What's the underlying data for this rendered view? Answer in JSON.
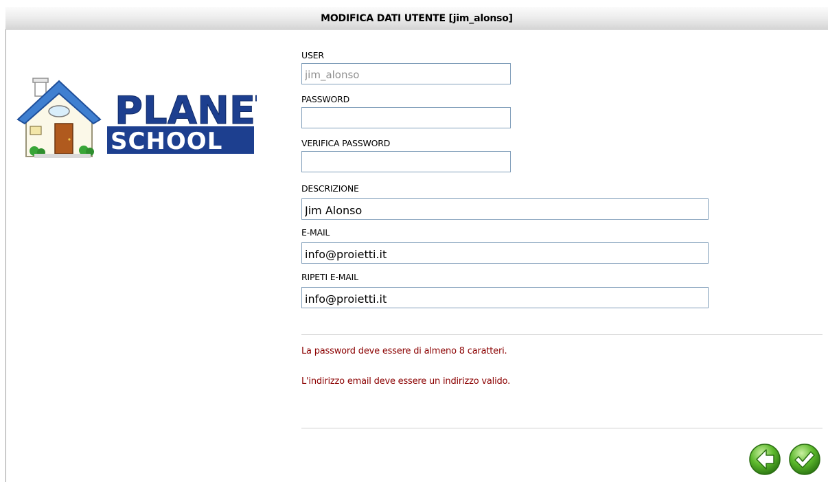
{
  "header": {
    "title": "MODIFICA DATI UTENTE [jim_alonso]"
  },
  "logo": {
    "line1": "PLANET",
    "line2": "SCHOOL"
  },
  "form": {
    "user": {
      "label": "USER",
      "value": "jim_alonso"
    },
    "password": {
      "label": "PASSWORD",
      "value": ""
    },
    "verify_password": {
      "label": "VERIFICA PASSWORD",
      "value": ""
    },
    "description": {
      "label": "DESCRIZIONE",
      "value": "Jim Alonso"
    },
    "email": {
      "label": "E-MAIL",
      "value": "info@proietti.it"
    },
    "repeat_email": {
      "label": "RIPETI E-MAIL",
      "value": "info@proietti.it"
    }
  },
  "errors": [
    "La password deve essere di almeno 8 caratteri.",
    "L'indirizzo email deve essere un indirizzo valido."
  ],
  "actions": {
    "back_icon": "arrow-left-icon",
    "confirm_icon": "check-icon"
  },
  "colors": {
    "error": "#8b0000",
    "button_green": "#5cb82c",
    "logo_blue": "#1d3f8f"
  }
}
